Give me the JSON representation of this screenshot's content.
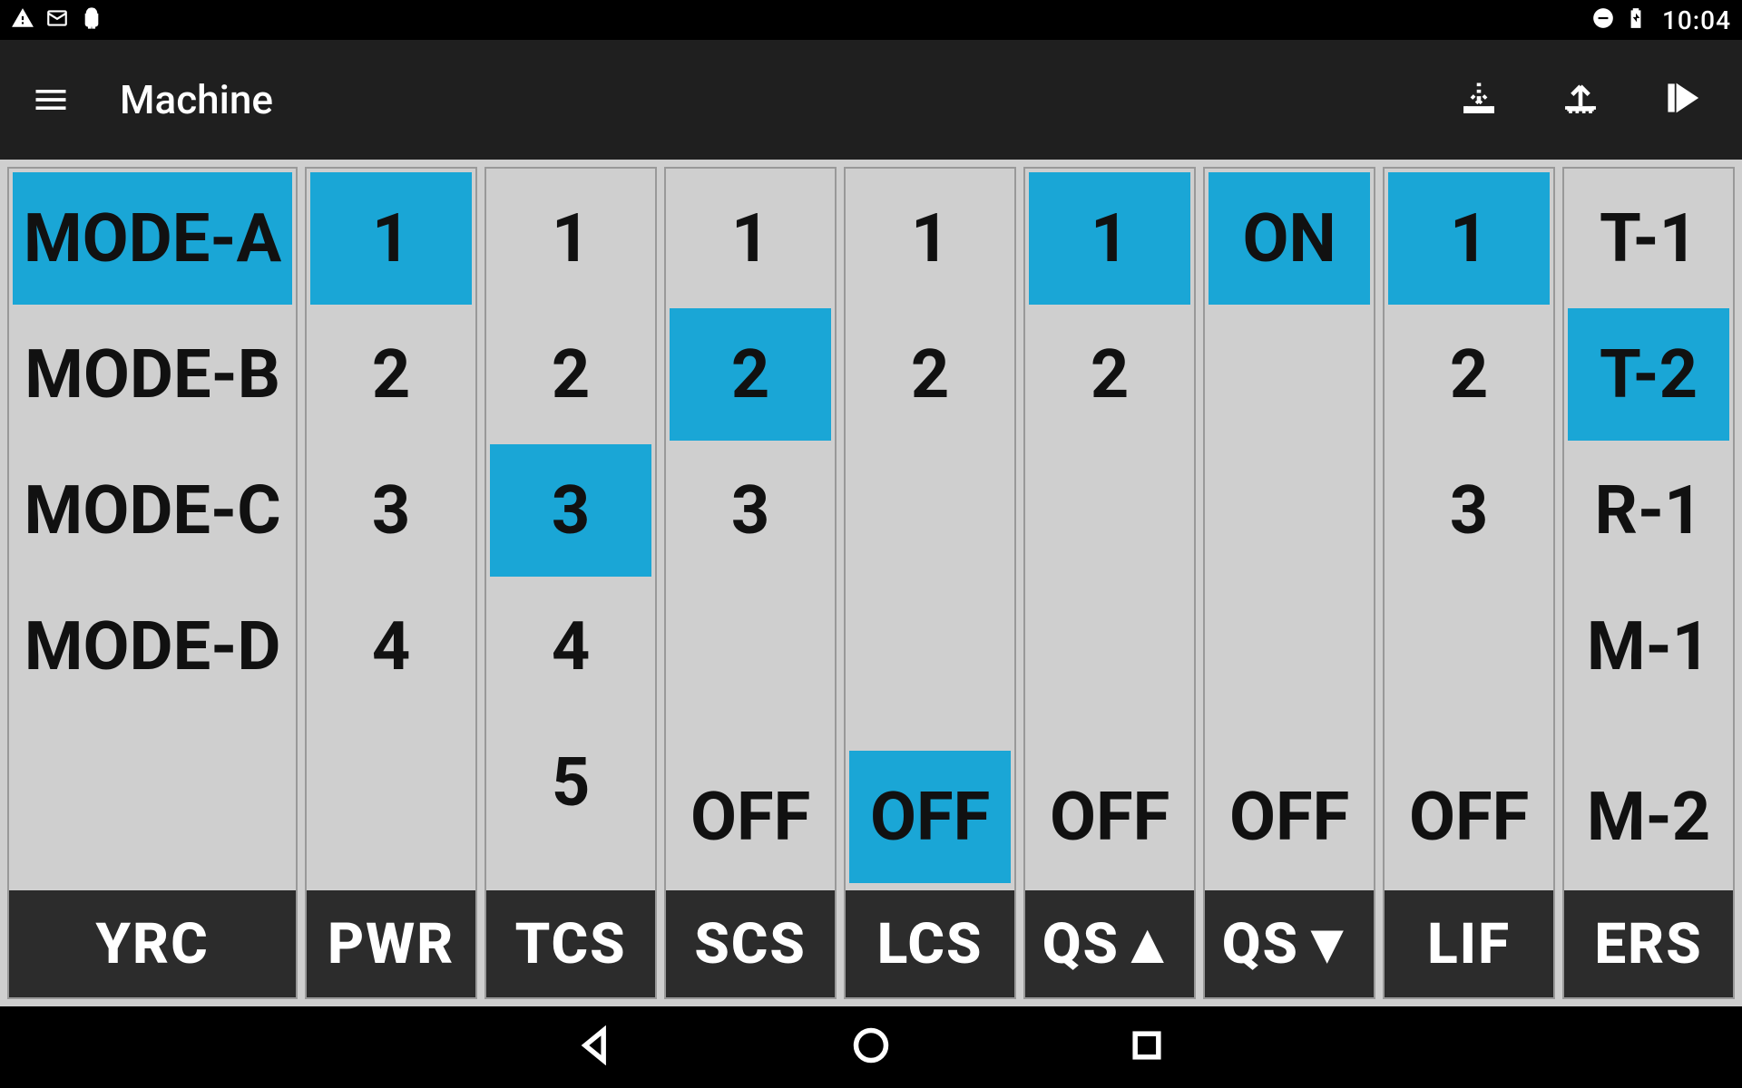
{
  "status": {
    "time": "10:04"
  },
  "appbar": {
    "title": "Machine"
  },
  "columns": [
    {
      "label": "YRC",
      "options": [
        "MODE-A",
        "MODE-B",
        "MODE-C",
        "MODE-D",
        "",
        ""
      ],
      "selected_index": 0
    },
    {
      "label": "PWR",
      "options": [
        "1",
        "2",
        "3",
        "4",
        "",
        ""
      ],
      "selected_index": 0
    },
    {
      "label": "TCS",
      "options": [
        "1",
        "2",
        "3",
        "4",
        "5",
        ""
      ],
      "selected_index": 2
    },
    {
      "label": "SCS",
      "options": [
        "1",
        "2",
        "3",
        "",
        "",
        "OFF"
      ],
      "selected_index": 1
    },
    {
      "label": "LCS",
      "options": [
        "1",
        "2",
        "",
        "",
        "",
        "OFF"
      ],
      "selected_index": 5
    },
    {
      "label": "QS▲",
      "options": [
        "1",
        "2",
        "",
        "",
        "",
        "OFF"
      ],
      "selected_index": 0
    },
    {
      "label": "QS▼",
      "options": [
        "ON",
        "",
        "",
        "",
        "",
        "OFF"
      ],
      "selected_index": 0
    },
    {
      "label": "LIF",
      "options": [
        "1",
        "2",
        "3",
        "",
        "",
        "OFF"
      ],
      "selected_index": 0
    },
    {
      "label": "ERS",
      "options": [
        "T-1",
        "T-2",
        "R-1",
        "M-1",
        "",
        "M-2"
      ],
      "selected_index": 1
    }
  ]
}
